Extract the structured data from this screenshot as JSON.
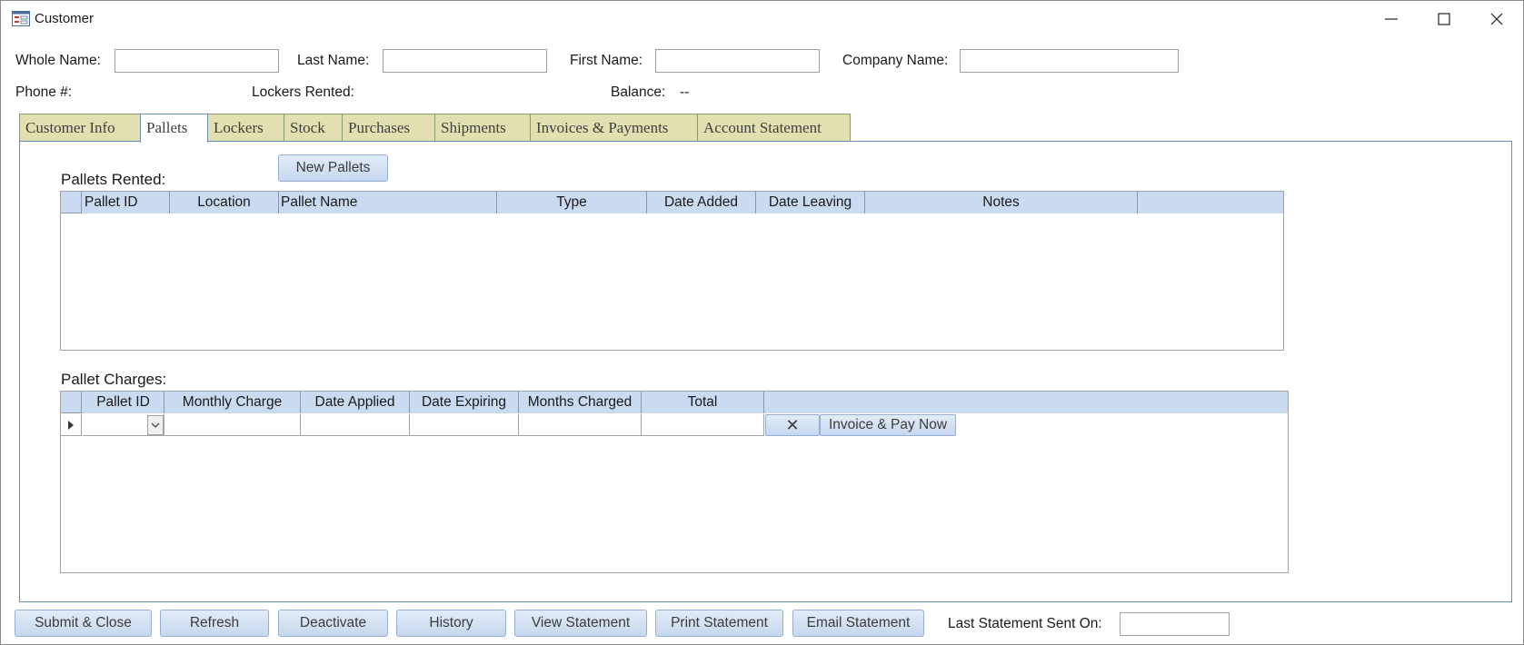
{
  "window": {
    "title": "Customer"
  },
  "header": {
    "whole_name_label": "Whole Name:",
    "whole_name_value": "",
    "last_name_label": "Last Name:",
    "last_name_value": "",
    "first_name_label": "First Name:",
    "first_name_value": "",
    "company_name_label": "Company Name:",
    "company_name_value": "",
    "phone_label": "Phone #:",
    "lockers_rented_label": "Lockers Rented:",
    "balance_label": "Balance:",
    "balance_value": "--"
  },
  "tabs": [
    {
      "label": "Customer Info",
      "active": false
    },
    {
      "label": "Pallets",
      "active": true
    },
    {
      "label": "Lockers",
      "active": false
    },
    {
      "label": "Stock",
      "active": false
    },
    {
      "label": "Purchases",
      "active": false
    },
    {
      "label": "Shipments",
      "active": false
    },
    {
      "label": "Invoices & Payments",
      "active": false
    },
    {
      "label": "Account Statement",
      "active": false
    }
  ],
  "pallets": {
    "section_label": "Pallets Rented:",
    "new_pallets_button": "New Pallets",
    "columns": [
      "Pallet ID",
      "Location",
      "Pallet Name",
      "Type",
      "Date Added",
      "Date Leaving",
      "Notes"
    ],
    "rows": []
  },
  "charges": {
    "section_label": "Pallet Charges:",
    "columns": [
      "Pallet ID",
      "Monthly Charge",
      "Date Applied",
      "Date Expiring",
      "Months Charged",
      "Total"
    ],
    "delete_glyph": "✕",
    "invoice_button": "Invoice & Pay Now"
  },
  "footer": {
    "buttons": [
      "Submit & Close",
      "Refresh",
      "Deactivate",
      "History",
      "View Statement",
      "Print Statement",
      "Email Statement"
    ],
    "last_statement_label": "Last Statement Sent On:",
    "last_statement_value": ""
  },
  "colors": {
    "tab_inactive": "#e2e0b0",
    "header_row": "#c9daf1",
    "panel_border": "#5f8dc1"
  }
}
